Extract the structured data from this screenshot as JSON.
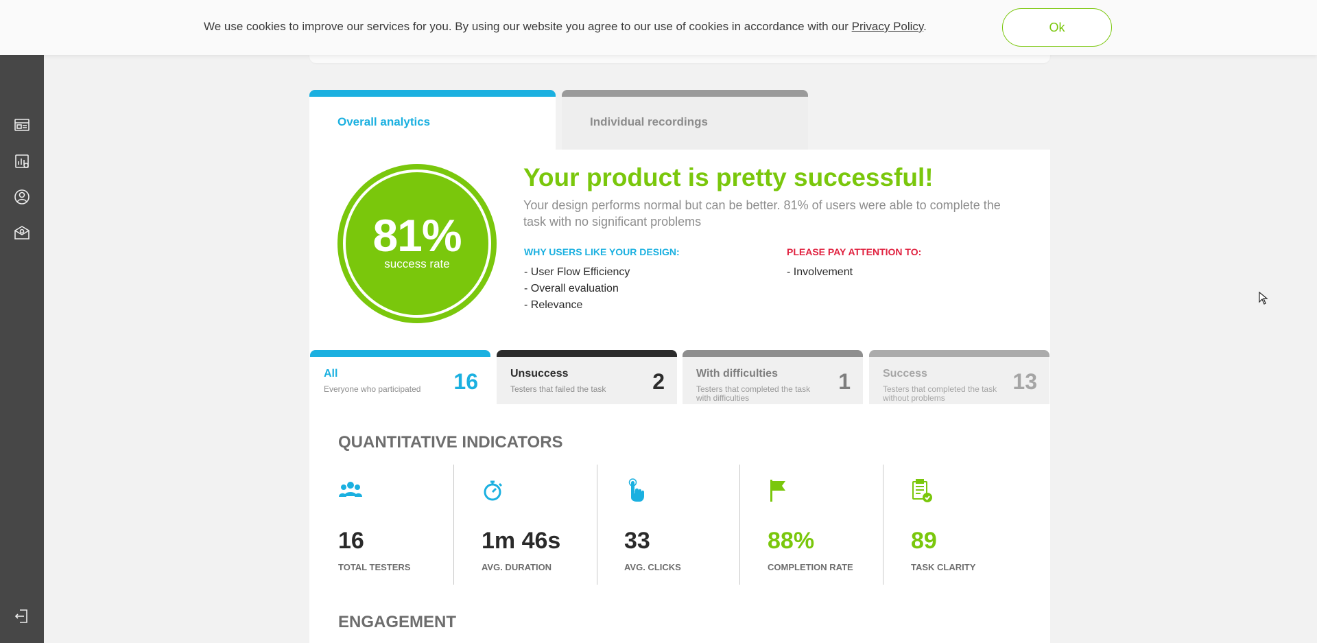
{
  "cookie": {
    "text": "We use cookies to improve our services for you. By using our website you agree to our use of cookies in accordance with our ",
    "link": "Privacy Policy",
    "suffix": ".",
    "ok_label": "Ok"
  },
  "tabs": {
    "overall": "Overall analytics",
    "individual": "Individual recordings"
  },
  "summary": {
    "success_pct": "81%",
    "success_label": "success rate",
    "headline": "Your product is pretty successful!",
    "subline": "Your design performs normal but can be better. 81% of users were able to complete the task with no significant problems",
    "why_title": "WHY USERS LIKE YOUR DESIGN:",
    "why_items": [
      "- User Flow Efficiency",
      "- Overall evaluation",
      "- Relevance"
    ],
    "attention_title": "PLEASE PAY ATTENTION TO:",
    "attention_items": [
      "- Involvement"
    ]
  },
  "filters": [
    {
      "title": "All",
      "subtitle": "Everyone who participated",
      "count": "16"
    },
    {
      "title": "Unsuccess",
      "subtitle": "Testers that failed the task",
      "count": "2"
    },
    {
      "title": "With difficulties",
      "subtitle": "Testers that completed the task with difficulties",
      "count": "1"
    },
    {
      "title": "Success",
      "subtitle": "Testers that completed the task without problems",
      "count": "13"
    }
  ],
  "sections": {
    "quantitative": "QUANTITATIVE INDICATORS",
    "engagement": "ENGAGEMENT"
  },
  "indicators": [
    {
      "value": "16",
      "label": "TOTAL TESTERS",
      "icon": "users-icon",
      "color": "#2a2a2a",
      "icon_color": "#1bb0e0"
    },
    {
      "value": "1m 46s",
      "label": "AVG. DURATION",
      "icon": "stopwatch-icon",
      "color": "#2a2a2a",
      "icon_color": "#1bb0e0"
    },
    {
      "value": "33",
      "label": "AVG. CLICKS",
      "icon": "pointer-hand-icon",
      "color": "#2a2a2a",
      "icon_color": "#1bb0e0"
    },
    {
      "value": "88%",
      "label": "COMPLETION RATE",
      "icon": "flag-icon",
      "color": "#7ac70c",
      "icon_color": "#7ac70c"
    },
    {
      "value": "89",
      "label": "TASK CLARITY",
      "icon": "clipboard-check-icon",
      "color": "#7ac70c",
      "icon_color": "#7ac70c"
    }
  ],
  "colors": {
    "accent_blue": "#1bb0e0",
    "success_green": "#7ac70c",
    "warning_red": "#e0213f",
    "sidebar": "#474747"
  }
}
